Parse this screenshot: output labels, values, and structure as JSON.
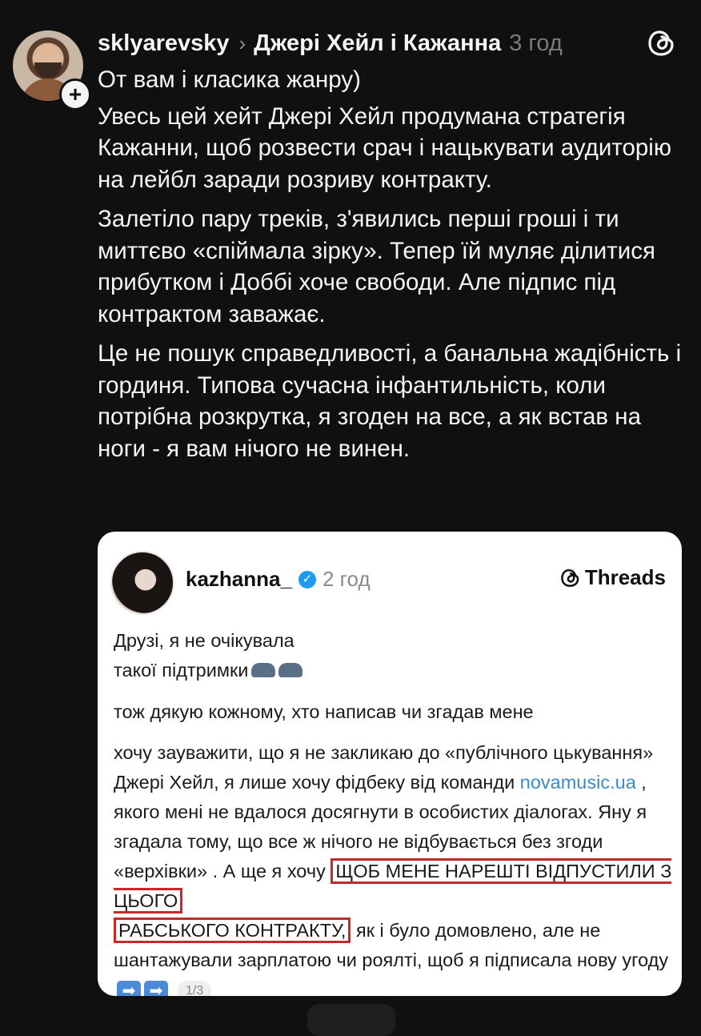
{
  "post": {
    "username": "sklyarevsky",
    "chevron": "›",
    "topic": "Джері Хейл і Кажанна",
    "time": "3 год",
    "follow_symbol": "+",
    "paragraphs": [
      "От вам і класика жанру)",
      "Увесь цей хейт Джері Хейл продумана стратегія Кажанни, щоб розвести срач і нацькувати аудиторію на лейбл заради розриву контракту.",
      "Залетіло пару треків, з'явились перші гроші і ти миттєво «спіймала зірку». Тепер їй муляє ділитися прибутком і Доббі хоче свободи. Але підпис під контрактом заважає.",
      "Це не пошук справедливості, а банальна жадібність і гординя. Типова сучасна інфантильність, коли потрібна розкрутка, я згоден на все, а як встав на ноги - я вам нічого не винен."
    ]
  },
  "card": {
    "username": "kazhanna_",
    "verified_symbol": "✓",
    "time": "2 год",
    "brand": "Threads",
    "line1": "Друзі, я не очікувала",
    "line2": "такої підтримки",
    "line3": "тож дякую кожному, хто  написав чи згадав мене",
    "p4_a": "хочу зауважити, що я не закликаю до «публічного цькування» Джері Хейл, я лише хочу фідбеку від команди ",
    "p4_link": "novamusic.ua",
    "p4_b": " , якого мені не вдалося досягнути в особистих діалогах. Яну я згадала тому, що все ж нічого не відбувається без згоди «верхівки» . А ще я хочу ",
    "highlight1": "ЩОБ МЕНЕ НАРЕШТІ ВІДПУСТИЛИ З ЦЬОГО",
    "highlight2": "РАБСЬКОГО КОНТРАКТУ,",
    "p4_c": " як і було домовлено, але не шантажували зарплатою чи роялті, щоб я підписала нову угоду ",
    "arrow": "➡",
    "page_indicator": "1/3"
  },
  "icons": {
    "threads_logo": "threads-logo-icon",
    "verified": "verified-badge-icon",
    "follow": "plus-icon"
  },
  "colors": {
    "background": "#101010",
    "highlight_border": "#c42a2a",
    "link": "#3a8bc8",
    "verified": "#1d9bf0"
  }
}
